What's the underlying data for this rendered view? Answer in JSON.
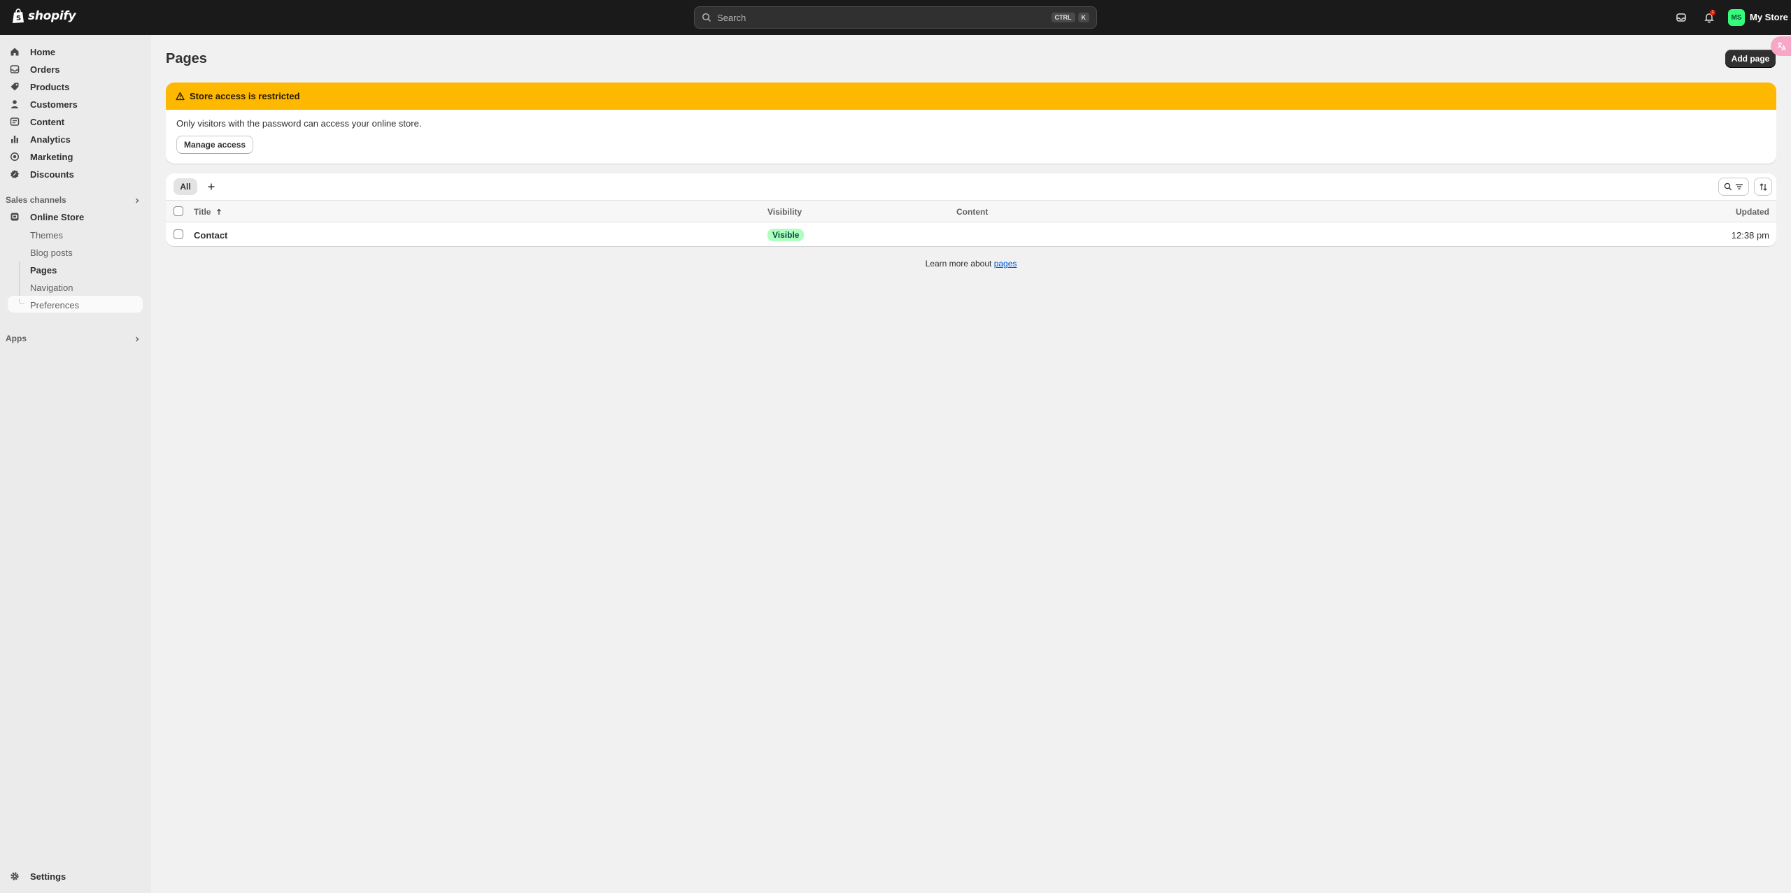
{
  "topbar": {
    "logo_text": "shopify",
    "search_placeholder": "Search",
    "shortcut_key1": "CTRL",
    "shortcut_key2": "K",
    "notification_count": "1",
    "store_initials": "MS",
    "store_name": "My Store"
  },
  "sidebar": {
    "items": [
      {
        "label": "Home",
        "icon": "home-icon"
      },
      {
        "label": "Orders",
        "icon": "orders-icon"
      },
      {
        "label": "Products",
        "icon": "products-icon"
      },
      {
        "label": "Customers",
        "icon": "customers-icon"
      },
      {
        "label": "Content",
        "icon": "content-icon"
      },
      {
        "label": "Analytics",
        "icon": "analytics-icon"
      },
      {
        "label": "Marketing",
        "icon": "marketing-icon"
      },
      {
        "label": "Discounts",
        "icon": "discounts-icon"
      }
    ],
    "sales_channels_title": "Sales channels",
    "online_store_label": "Online Store",
    "sub_items": [
      "Themes",
      "Blog posts",
      "Pages",
      "Navigation",
      "Preferences"
    ],
    "active_sub_item": "Pages",
    "apps_title": "Apps",
    "settings_label": "Settings"
  },
  "main": {
    "title": "Pages",
    "add_button": "Add page",
    "banner": {
      "title": "Store access is restricted",
      "text": "Only visitors with the password can access your online store.",
      "button": "Manage access"
    },
    "tabs": {
      "all": "All"
    },
    "table": {
      "headers": {
        "title": "Title",
        "visibility": "Visibility",
        "content": "Content",
        "updated": "Updated"
      },
      "rows": [
        {
          "title": "Contact",
          "visibility": "Visible",
          "content": "",
          "updated": "12:38 pm"
        }
      ]
    },
    "learn_more_prefix": "Learn more about",
    "learn_more_link": "pages"
  },
  "colors": {
    "topbar_bg": "#1a1a1a",
    "banner_warning": "#ffb800",
    "visible_badge_bg": "#affebf",
    "primary_button": "#303030",
    "link": "#005bd3",
    "avatar_bg": "#36fc7e"
  }
}
